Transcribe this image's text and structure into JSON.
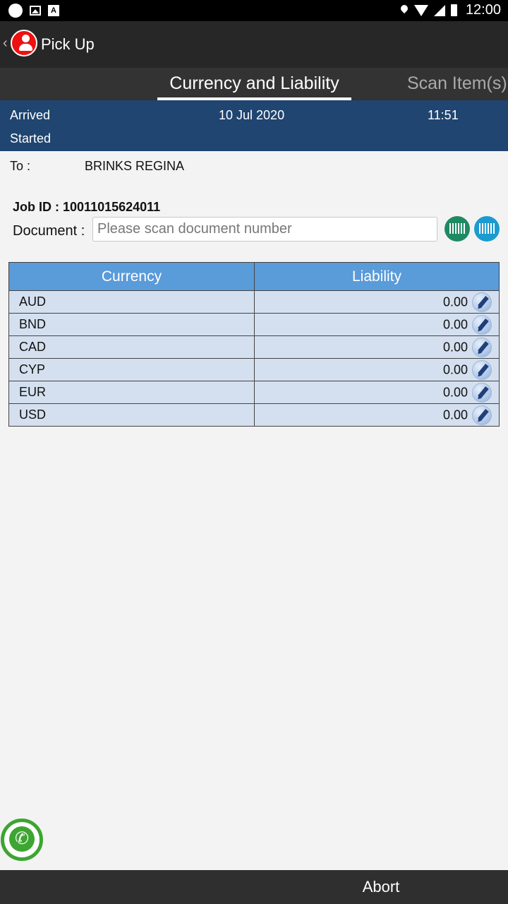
{
  "status_bar": {
    "time": "12:00",
    "notification_icons": [
      "circle-icon",
      "image-icon",
      "a-icon"
    ]
  },
  "app_bar": {
    "title": "Pick Up"
  },
  "tabs": [
    {
      "label": "Currency and Liability",
      "active": true
    },
    {
      "label": "Scan Item(s)",
      "active": false
    }
  ],
  "info": {
    "arrived_label": "Arrived",
    "started_label": "Started",
    "date": "10 Jul 2020",
    "time": "11:51"
  },
  "to": {
    "label": "To :",
    "value": "BRINKS REGINA"
  },
  "job": {
    "label": "Job ID :",
    "value": "10011015624011"
  },
  "document": {
    "label": "Document :",
    "placeholder": "Please scan document number",
    "value": ""
  },
  "table": {
    "headers": [
      "Currency",
      "Liability"
    ],
    "rows": [
      {
        "currency": "AUD",
        "liability": "0.00"
      },
      {
        "currency": "BND",
        "liability": "0.00"
      },
      {
        "currency": "CAD",
        "liability": "0.00"
      },
      {
        "currency": "CYP",
        "liability": "0.00"
      },
      {
        "currency": "EUR",
        "liability": "0.00"
      },
      {
        "currency": "USD",
        "liability": "0.00"
      }
    ]
  },
  "footer": {
    "abort_label": "Abort"
  },
  "colors": {
    "info_bar": "#1f4570",
    "table_header": "#5a9bd9",
    "table_row": "#d4e0ef",
    "scan_green": "#1e8a63",
    "scan_blue": "#1b9bd0",
    "phone_green": "#3da531"
  }
}
